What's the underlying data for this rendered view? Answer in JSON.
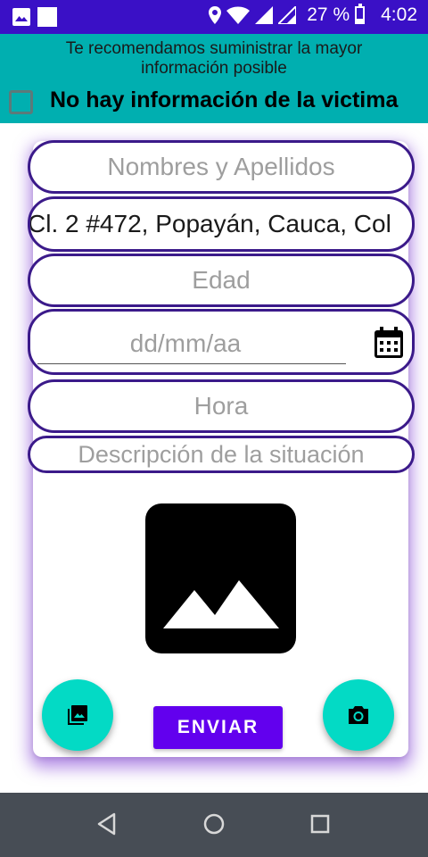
{
  "status_bar": {
    "battery": "27 %",
    "time": "4:02",
    "icons": [
      "image-notification-icon",
      "square-notification-icon",
      "location-icon",
      "wifi-icon",
      "signal-icon",
      "signal-icon-2",
      "battery-icon"
    ],
    "battery_level": 0.27,
    "background_color": "#3a10c6"
  },
  "banner": {
    "recommendation": "Te recomendamos suministrar la mayor información posible",
    "no_info_checkbox_label": "No hay información de la victima",
    "no_info_checked": false,
    "background_color": "#00afb0"
  },
  "form": {
    "name_placeholder": "Nombres y Apellidos",
    "address_value": "Cl. 2 #472, Popayán, Cauca, Col",
    "age_placeholder": "Edad",
    "date_placeholder": "dd/mm/aa",
    "time_placeholder": "Hora",
    "description_placeholder": "Descripción de la situación",
    "field_border_color": "#3b1a8a"
  },
  "actions": {
    "send_label": "ENVIAR",
    "gallery_icon": "photo-library-icon",
    "camera_icon": "camera-icon",
    "fab_color": "#03dac5",
    "send_color": "#6200ee"
  },
  "nav": {
    "icons": [
      "back-icon",
      "home-icon",
      "recents-icon"
    ]
  }
}
